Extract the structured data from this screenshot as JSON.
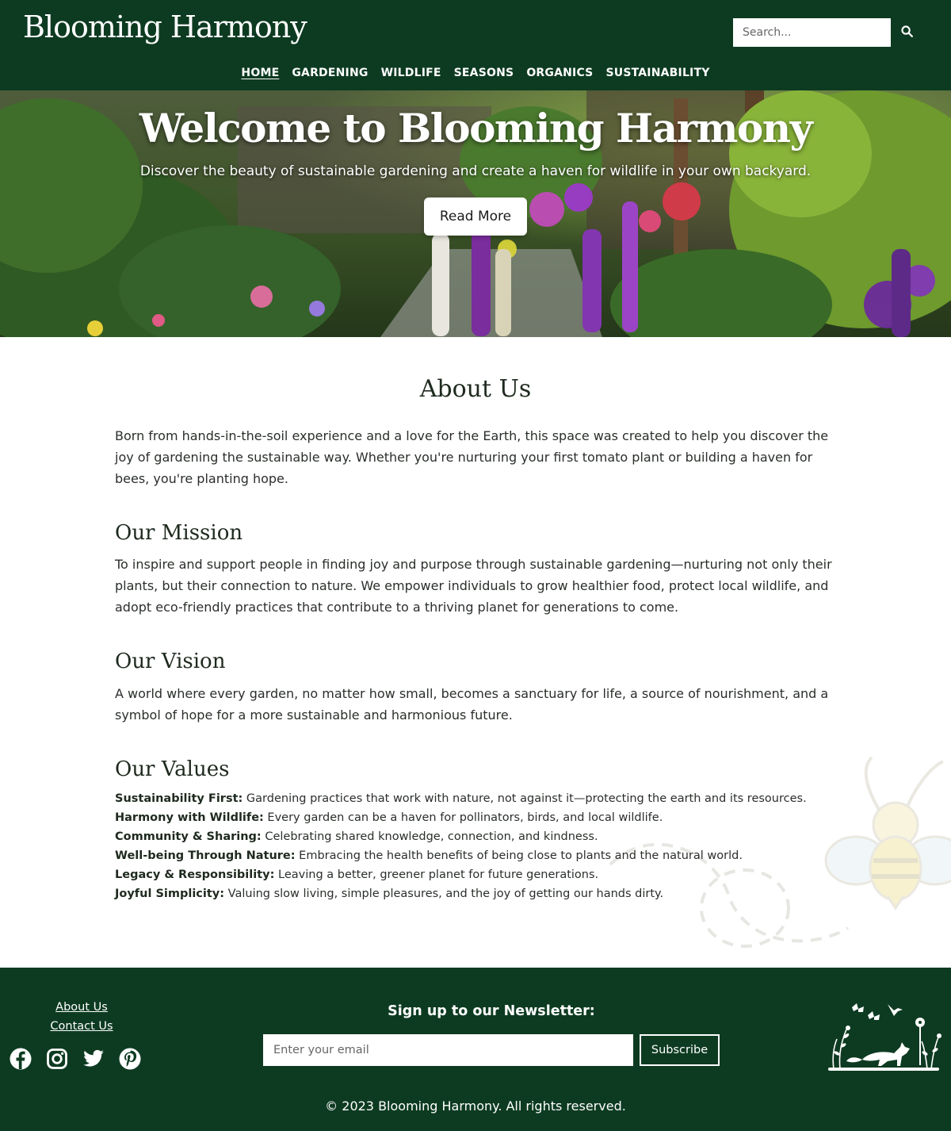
{
  "header": {
    "logo": "Blooming Harmony",
    "search_placeholder": "Search...",
    "nav": [
      {
        "label": "HOME",
        "active": true
      },
      {
        "label": "GARDENING"
      },
      {
        "label": "WILDLIFE"
      },
      {
        "label": "SEASONS"
      },
      {
        "label": "ORGANICS"
      },
      {
        "label": "SUSTAINABILITY"
      }
    ]
  },
  "hero": {
    "title": "Welcome to Blooming Harmony",
    "subtitle": "Discover the beauty of sustainable gardening and create a haven for wildlife in your own backyard.",
    "button": "Read More"
  },
  "about": {
    "title": "About Us",
    "intro": "Born from hands-in-the-soil experience and a love for the Earth, this space was created to help you discover the joy of gardening the sustainable way. Whether you're nurturing your first tomato plant or building a haven for bees, you're planting hope.",
    "mission_title": "Our Mission",
    "mission": "To inspire and support people in finding joy and purpose through sustainable gardening—nurturing not only their plants, but their connection to nature. We empower individuals to grow healthier food, protect local wildlife, and adopt eco-friendly practices that contribute to a thriving planet for generations to come.",
    "vision_title": "Our Vision",
    "vision": "A world where every garden, no matter how small, becomes a sanctuary for life, a source of nourishment, and a symbol of hope for a more sustainable and harmonious future.",
    "values_title": "Our Values",
    "values": [
      {
        "name": "Sustainability First:",
        "text": " Gardening practices that work with nature, not against it—protecting the earth and its resources."
      },
      {
        "name": "Harmony with Wildlife:",
        "text": " Every garden can be a haven for pollinators, birds, and local wildlife."
      },
      {
        "name": "Community & Sharing:",
        "text": " Celebrating shared knowledge, connection, and kindness."
      },
      {
        "name": "Well-being Through Nature:",
        "text": " Embracing the health benefits of being close to plants and the natural world."
      },
      {
        "name": "Legacy & Responsibility:",
        "text": " Leaving a better, greener planet for future generations."
      },
      {
        "name": "Joyful Simplicity:",
        "text": " Valuing slow living, simple pleasures, and the joy of getting our hands dirty."
      }
    ]
  },
  "footer": {
    "links": [
      "About Us",
      "Contact Us"
    ],
    "socials": [
      "facebook-icon",
      "instagram-icon",
      "twitter-icon",
      "pinterest-icon"
    ],
    "newsletter_title": "Sign up to our Newsletter:",
    "email_placeholder": "Enter your email",
    "subscribe": "Subscribe",
    "copyright": "© 2023 Blooming Harmony. All rights reserved."
  },
  "colors": {
    "brand_green": "#0d3b21",
    "text": "#1f2a1f",
    "white": "#ffffff"
  }
}
